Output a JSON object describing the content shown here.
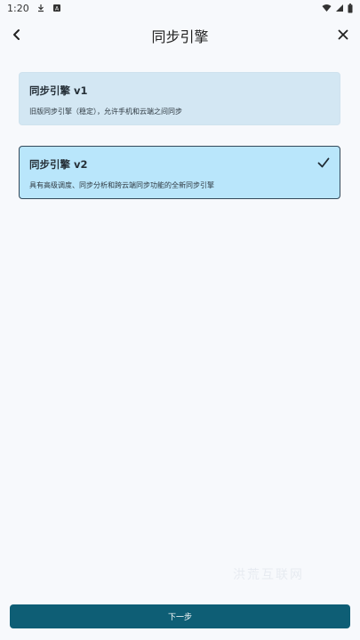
{
  "status_bar": {
    "time": "1:20",
    "left_icons": [
      "download-icon",
      "translate-icon"
    ],
    "right_icons": [
      "wifi-icon",
      "signal-icon",
      "battery-icon"
    ]
  },
  "header": {
    "title": "同步引擎",
    "back_icon": "chevron-left-icon",
    "close_icon": "close-icon"
  },
  "options": [
    {
      "title": "同步引擎 v1",
      "description": "旧版同步引擎（稳定），允许手机和云端之间同步",
      "selected": false
    },
    {
      "title": "同步引擎 v2",
      "description": "具有高级调度、同步分析和跨云端同步功能的全新同步引擎",
      "selected": true
    }
  ],
  "watermark": "洪荒互联网",
  "footer": {
    "next_label": "下一步"
  },
  "colors": {
    "background": "#f7f9fc",
    "option_v1_bg": "#d3e7f3",
    "option_v2_bg": "#b9e6fb",
    "selected_border": "#33495a",
    "primary_button": "#0e5e75"
  }
}
